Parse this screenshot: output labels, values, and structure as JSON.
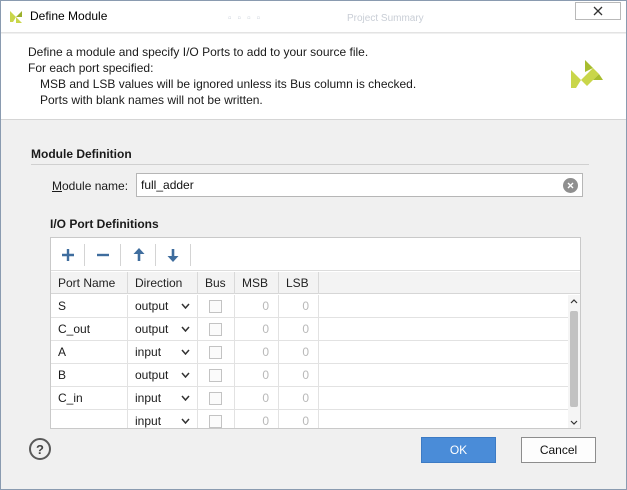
{
  "window": {
    "title": "Define Module",
    "background_title": "Project Summary"
  },
  "header": {
    "line1": "Define a module and specify I/O Ports to add to your source file.",
    "line2": "For each port specified:",
    "line3": "MSB and LSB values will be ignored unless its Bus column is checked.",
    "line4": "Ports with blank names will not be written."
  },
  "module_definition": {
    "section_title": "Module Definition",
    "name_label_prefix": "M",
    "name_label_rest": "odule name:",
    "name_value": "full_adder"
  },
  "io_ports": {
    "section_title": "I/O Port Definitions",
    "columns": [
      "Port Name",
      "Direction",
      "Bus",
      "MSB",
      "LSB"
    ],
    "rows": [
      {
        "name": "S",
        "direction": "output",
        "msb": "0",
        "lsb": "0"
      },
      {
        "name": "C_out",
        "direction": "output",
        "msb": "0",
        "lsb": "0"
      },
      {
        "name": "A",
        "direction": "input",
        "msb": "0",
        "lsb": "0"
      },
      {
        "name": "B",
        "direction": "output",
        "msb": "0",
        "lsb": "0"
      },
      {
        "name": "C_in",
        "direction": "input",
        "msb": "0",
        "lsb": "0"
      },
      {
        "name": "",
        "direction": "input",
        "msb": "0",
        "lsb": "0"
      }
    ]
  },
  "footer": {
    "help_label": "?",
    "ok_label": "OK",
    "cancel_label": "Cancel"
  },
  "colors": {
    "primary_button": "#4a8cd8",
    "brand": "#c9d64a",
    "toolbar_icon": "#3f6d9e"
  }
}
